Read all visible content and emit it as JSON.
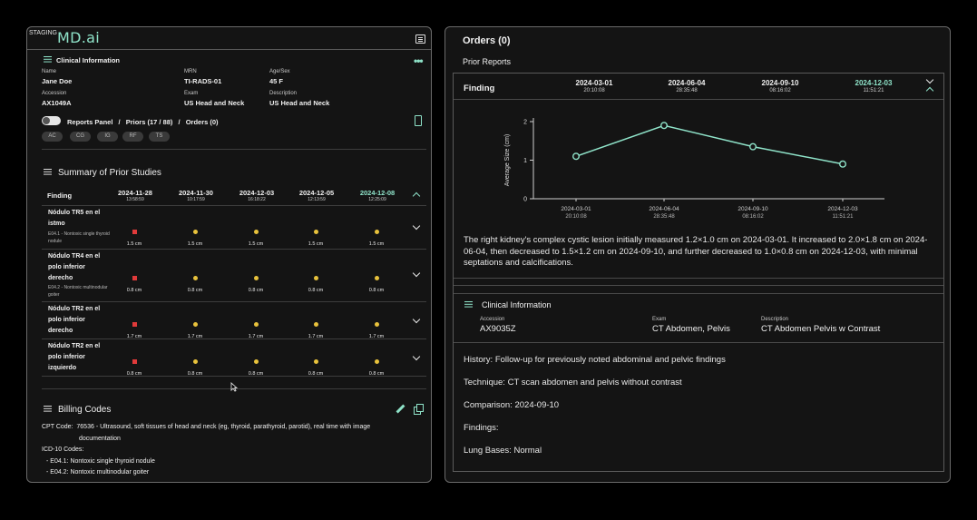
{
  "left": {
    "staging": "STAGING",
    "logo": "MD.ai",
    "clinical": {
      "title": "Clinical Information",
      "name_label": "Name",
      "name": "Jane Doe",
      "mrn_label": "MRN",
      "mrn": "TI-RADS-01",
      "age_label": "Age/Sex",
      "age": "45 F",
      "accession_label": "Accession",
      "accession": "AX1049A",
      "exam_label": "Exam",
      "exam": "US Head and Neck",
      "desc_label": "Description",
      "desc": "US Head and Neck"
    },
    "crumbs": {
      "reports": "Reports Panel",
      "priors": "Priors (17 / 88)",
      "orders": "Orders (0)",
      "sep": "/"
    },
    "chips": [
      "AC",
      "CG",
      "IG",
      "RF",
      "TS"
    ],
    "summary": {
      "title": "Summary of Prior Studies",
      "finding_header": "Finding",
      "dates": [
        {
          "date": "2024-11-28",
          "time": "13:58:59"
        },
        {
          "date": "2024-11-30",
          "time": "10:17:59"
        },
        {
          "date": "2024-12-03",
          "time": "16:18:22"
        },
        {
          "date": "2024-12-05",
          "time": "12:13:59"
        },
        {
          "date": "2024-12-08",
          "time": "12:25:09"
        }
      ],
      "rows": [
        {
          "name": "Nódulo TR5 en el istmo",
          "sub": "E04.1 - Nontoxic single thyroid nodule",
          "values": [
            "1.5 cm",
            "1.5 cm",
            "1.5 cm",
            "1.5 cm",
            "1.5 cm"
          ]
        },
        {
          "name": "Nódulo TR4 en el polo inferior derecho",
          "sub": "E04.2 - Nontoxic multinodular goiter",
          "values": [
            "0.8 cm",
            "0.8 cm",
            "0.8 cm",
            "0.8 cm",
            "0.8 cm"
          ]
        },
        {
          "name": "Nódulo TR2 en el polo inferior derecho",
          "sub": "",
          "values": [
            "1.7 cm",
            "1.7 cm",
            "1.7 cm",
            "1.7 cm",
            "1.7 cm"
          ]
        },
        {
          "name": "Nódulo TR2 en el polo inferior izquierdo",
          "sub": "",
          "values": [
            "0.8 cm",
            "0.8 cm",
            "0.8 cm",
            "0.8 cm",
            "0.8 cm"
          ]
        }
      ]
    },
    "billing": {
      "title": "Billing Codes",
      "cpt_label": "CPT Code:",
      "cpt_code": "76536",
      "cpt_desc_1": "- Ultrasound, soft tissues of head and neck (eg, thyroid, parathyroid, parotid), real time with image",
      "cpt_desc_2": "documentation",
      "icd_label": "ICD-10 Codes:",
      "icd_1": "- E04.1: Nontoxic single thyroid nodule",
      "icd_2": "- E04.2: Nontoxic multinodular goiter"
    }
  },
  "right": {
    "orders_title": "Orders (0)",
    "prior_reports": "Prior Reports",
    "finding_header": "Finding",
    "dates": [
      {
        "date": "2024-03-01",
        "time": "20:10:08"
      },
      {
        "date": "2024-06-04",
        "time": "28:35:48"
      },
      {
        "date": "2024-09-10",
        "time": "08:16:02"
      },
      {
        "date": "2024-12-03",
        "time": "11:51:21"
      }
    ],
    "report_text": "The right kidney's complex cystic lesion initially measured 1.2×1.0 cm on 2024-03-01. It increased to 2.0×1.8 cm on 2024-06-04, then decreased to 1.5×1.2 cm on 2024-09-10, and further decreased to 1.0×0.8 cm on 2024-12-03, with minimal septations and calcifications.",
    "clinical": {
      "title": "Clinical Information",
      "accession_label": "Accession",
      "accession": "AX9035Z",
      "exam_label": "Exam",
      "exam": "CT Abdomen, Pelvis",
      "desc_label": "Description",
      "desc": "CT Abdomen Pelvis w Contrast"
    },
    "history": "History: Follow-up for previously noted abdominal and pelvic findings",
    "technique": "Technique: CT scan abdomen and pelvis without contrast",
    "comparison": "Comparison: 2024-09-10",
    "findings": "Findings:",
    "lung": "Lung Bases: Normal"
  },
  "colors": {
    "accent": "#8fe3c9",
    "red_marker": "#e03a3a",
    "yellow_marker": "#e8c23c"
  },
  "chart_data": {
    "type": "line",
    "x": [
      "2024-03-01",
      "2024-06-04",
      "2024-09-10",
      "2024-12-03"
    ],
    "x_time": [
      "20:10:08",
      "28:35:48",
      "08:16:02",
      "11:51:21"
    ],
    "series": [
      {
        "values": [
          1.1,
          1.9,
          1.35,
          0.9
        ]
      }
    ],
    "ylabel": "Average Size (cm)",
    "yticks": [
      0,
      1,
      2
    ],
    "ylim": [
      0,
      2
    ],
    "grid": false
  }
}
